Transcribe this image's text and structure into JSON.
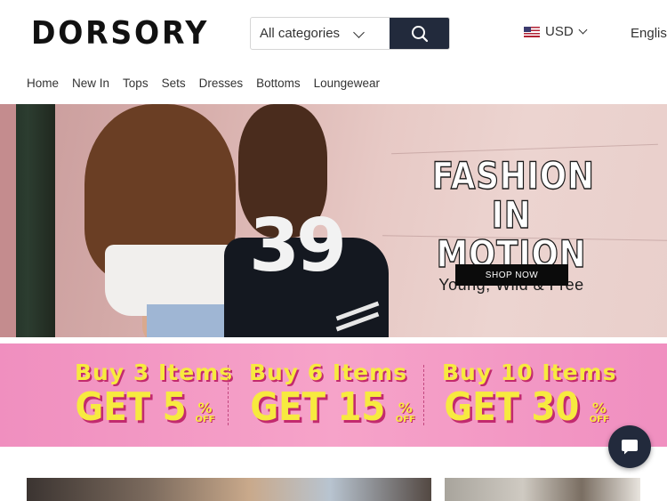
{
  "header": {
    "logo": "DORSORY",
    "search": {
      "category_selected": "All categories",
      "search_icon": "search-icon"
    },
    "currency": {
      "label": "USD",
      "flag_icon": "us-flag-icon"
    },
    "language": "English"
  },
  "nav": {
    "items": [
      {
        "label": "Home"
      },
      {
        "label": "New In"
      },
      {
        "label": "Tops"
      },
      {
        "label": "Sets"
      },
      {
        "label": "Dresses"
      },
      {
        "label": "Bottoms"
      },
      {
        "label": "Loungewear"
      }
    ]
  },
  "hero": {
    "title_line1": "FASHION",
    "title_line2": "IN MOTION",
    "subtitle": "Young, Wild & Free",
    "cta": "SHOP NOW",
    "jersey_number": "39"
  },
  "promo": {
    "items": [
      {
        "line1": "Buy 3 Items",
        "get": "GET 5",
        "percent": "%",
        "off": "OFF"
      },
      {
        "line1": "Buy 6 Items",
        "get": "GET 15",
        "percent": "%",
        "off": "OFF"
      },
      {
        "line1": "Buy 10 Items",
        "get": "GET 30",
        "percent": "%",
        "off": "OFF"
      }
    ],
    "text_color": "#f7ea3f",
    "shadow_color": "#c22a6f"
  },
  "chat": {
    "icon": "chat-bubble-icon"
  },
  "colors": {
    "accent_dark": "#222a3c",
    "promo_pink": "#f6a3c9"
  }
}
